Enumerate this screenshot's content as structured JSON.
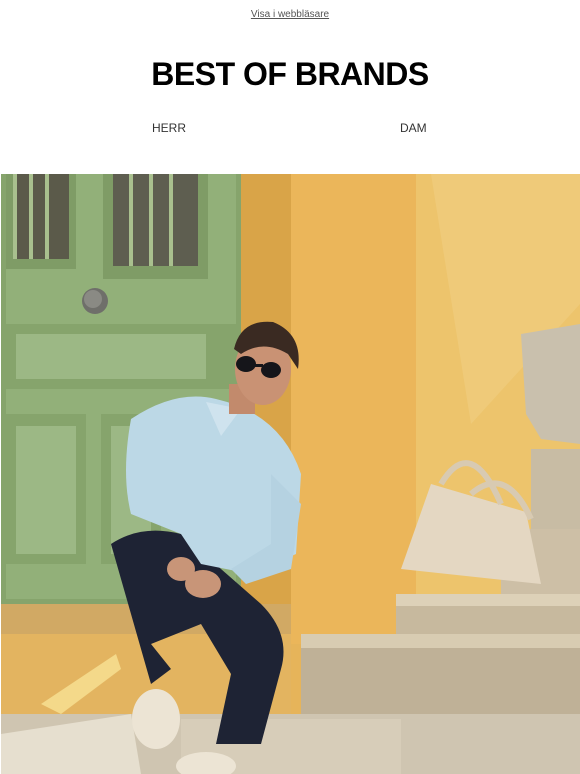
{
  "preheader": {
    "label": "Visa i webbläsare"
  },
  "brand": {
    "logo_text": "BEST OF BRANDS"
  },
  "nav": {
    "items": [
      {
        "label": "HERR"
      },
      {
        "label": "DAM"
      }
    ]
  },
  "hero": {
    "icon": "hero-photo",
    "colors": {
      "door_green": "#8fad75",
      "wall_yellow": "#e8b85a",
      "shirt_blue": "#bcd8e6",
      "pants_navy": "#1d2233",
      "steps_stone": "#cfc3ad"
    }
  }
}
